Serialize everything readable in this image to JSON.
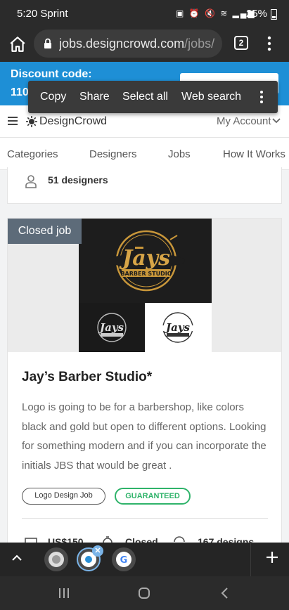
{
  "status": {
    "time": "5:20 Sprint",
    "battery": "25%"
  },
  "browser": {
    "url_main": "jobs.designcrowd.com",
    "url_path": "/jobs/",
    "tab_count": "2"
  },
  "context_menu": {
    "items": [
      "Copy",
      "Share",
      "Select all",
      "Web search"
    ]
  },
  "promo": {
    "line1": "Discount code:",
    "line2": "110"
  },
  "header": {
    "logo": "DesignCrowd",
    "account": "My Account"
  },
  "nav": {
    "items": [
      "Categories",
      "Designers",
      "Jobs",
      "How It Works"
    ]
  },
  "prev_card": {
    "designers": "51 designers"
  },
  "job": {
    "status_badge": "Closed job",
    "title": "Jay’s Barber Studio*",
    "description": "Logo is going to be for a barbershop, like colors black and gold but open to different options. Looking for something modern and if you can incorporate the initials JBS that would be great .",
    "tags": [
      "Logo Design Job",
      "GUARANTEED"
    ],
    "meta": {
      "price": "US$150",
      "status": "Closed",
      "designs": "167 designs"
    }
  },
  "colors": {
    "promo": "#1e8fd6",
    "guaranteed": "#2fb36a",
    "badge": "#5d6b79"
  }
}
